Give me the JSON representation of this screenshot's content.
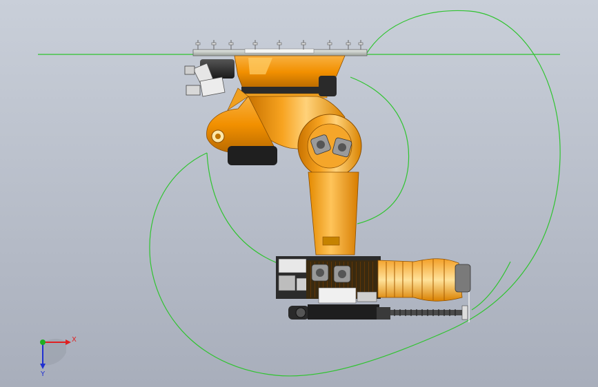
{
  "scene": {
    "background_top": "#c9cfd9",
    "background_bottom": "#a8aebb",
    "robot_orange": "#f49a12",
    "robot_highlight": "#ffd37a",
    "robot_shadow": "#b86a00",
    "workspace_line_color": "#2fc42f"
  },
  "triad": {
    "x_label": "X",
    "y_label": "Y",
    "x_color": "#e02020",
    "y_color": "#2030d0",
    "z_color": "#20b020"
  },
  "icons": {
    "triad": "coordinate-triad-icon"
  }
}
